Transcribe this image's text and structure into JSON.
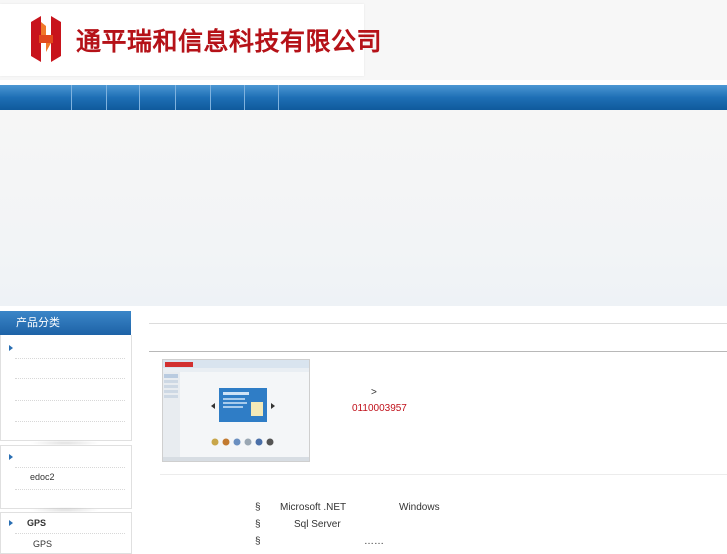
{
  "header": {
    "company_name": "通平瑞和信息科技有限公司",
    "logo_icon": "company-logo-icon"
  },
  "nav": {
    "items": [
      "",
      "",
      "",
      "",
      "",
      "",
      "",
      ""
    ]
  },
  "sidebar": {
    "title": "产品分类",
    "group1": {
      "items": [
        ""
      ]
    },
    "group2": {
      "items": [
        "",
        "edoc2"
      ]
    },
    "group3": {
      "items": [
        "GPS",
        "GPS"
      ]
    }
  },
  "product": {
    "breadcrumb_sep": ">",
    "phone": "0110003957",
    "features": [
      {
        "bullet": "§",
        "text": "Microsoft .NET",
        "extra": "Windows"
      },
      {
        "bullet": "§",
        "text": "Sql Server",
        "extra": ""
      },
      {
        "bullet": "§",
        "text": "",
        "extra": "……"
      }
    ]
  },
  "colors": {
    "brand_red": "#b51218",
    "nav_blue": "#1e6fb5",
    "phone_red": "#c0101a"
  }
}
